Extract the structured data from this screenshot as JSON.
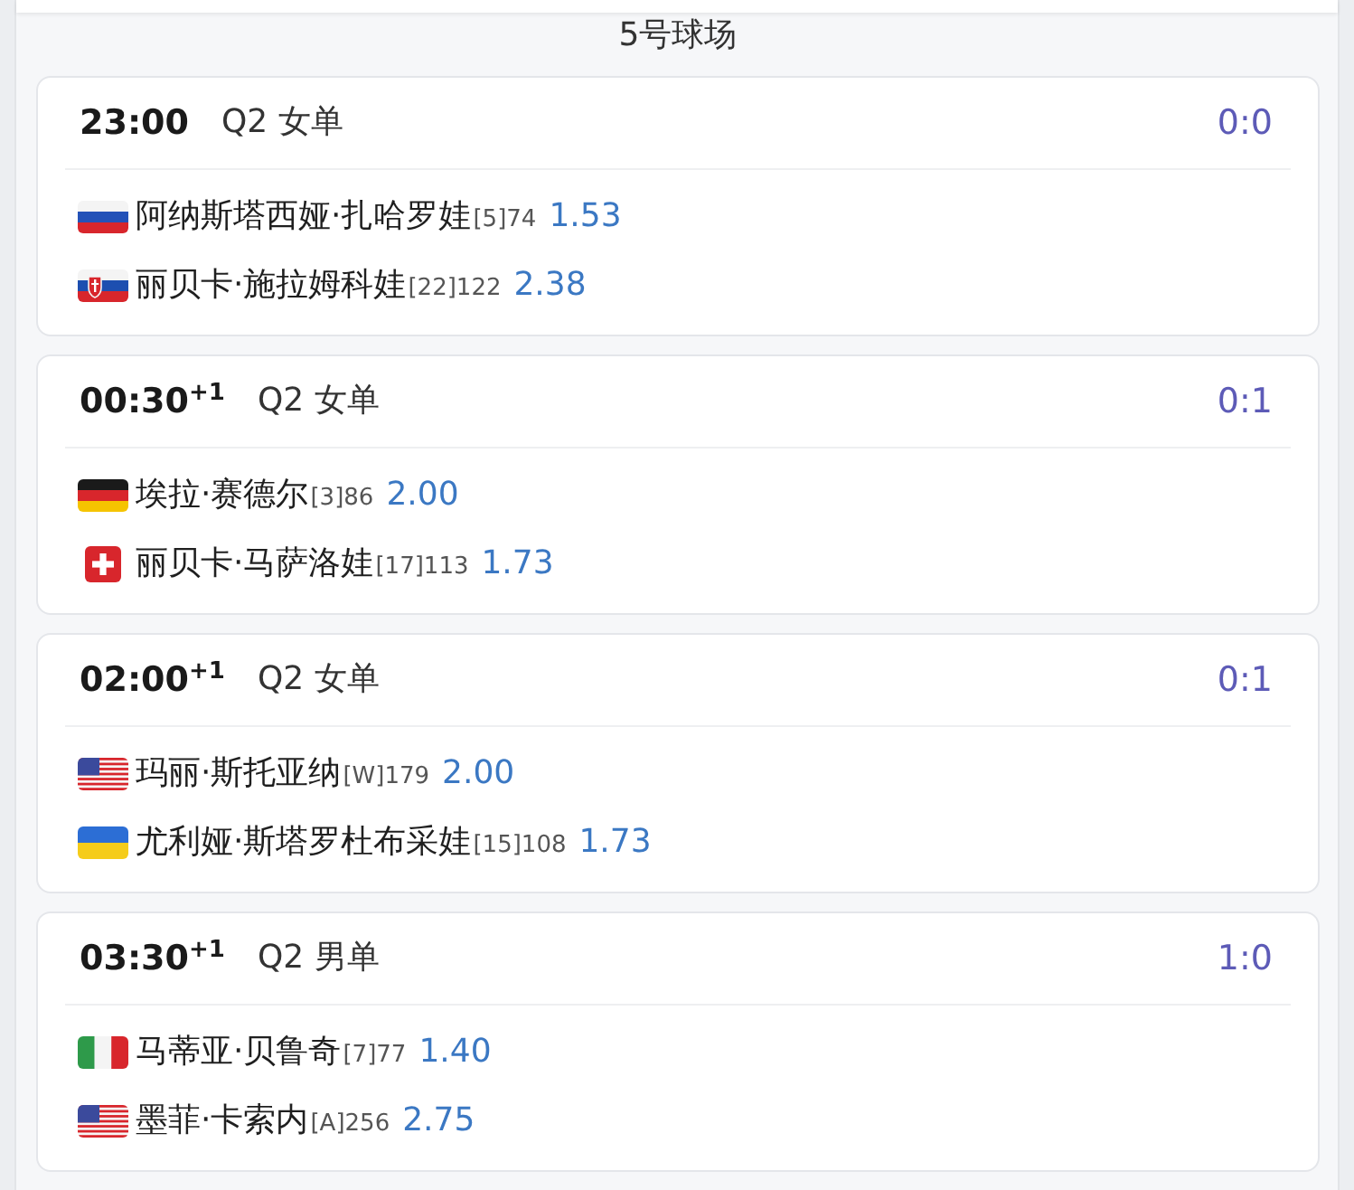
{
  "court": {
    "title": "5号球场"
  },
  "matches": [
    {
      "time": "23:00",
      "round": "Q2 女单",
      "score": "0:0",
      "players": [
        {
          "kind": "russia",
          "name": "阿纳斯塔西娅·扎哈罗娃",
          "seed_rank": "[5]74",
          "odds": "1.53"
        },
        {
          "kind": "slovakia",
          "name": "丽贝卡·施拉姆科娃",
          "seed_rank": "[22]122",
          "odds": "2.38"
        }
      ]
    },
    {
      "time": "00:30$^{+1}$",
      "round": "Q2 女单",
      "score": "0:1",
      "players": [
        {
          "kind": "germany",
          "name": "埃拉·赛德尔",
          "seed_rank": "[3]86",
          "odds": "2.00"
        },
        {
          "kind": "switzerland",
          "name": "丽贝卡·马萨洛娃",
          "seed_rank": "[17]113",
          "odds": "1.73"
        }
      ]
    },
    {
      "time": "02:00$^{+1}$",
      "round": "Q2 女单",
      "score": "0:1",
      "players": [
        {
          "kind": "usa",
          "name": "玛丽·斯托亚纳",
          "seed_rank": "[W]179",
          "odds": "2.00"
        },
        {
          "kind": "ukraine",
          "name": "尤利娅·斯塔罗杜布采娃",
          "seed_rank": "[15]108",
          "odds": "1.73"
        }
      ]
    },
    {
      "time": "03:30$^{+1}$",
      "round": "Q2 男单",
      "score": "1:0",
      "players": [
        {
          "kind": "italy",
          "name": "马蒂亚·贝鲁奇",
          "seed_rank": "[7]77",
          "odds": "1.40"
        },
        {
          "kind": "usa",
          "name": "墨菲·卡索内",
          "seed_rank": "[A]256",
          "odds": "2.75"
        }
      ]
    }
  ]
}
